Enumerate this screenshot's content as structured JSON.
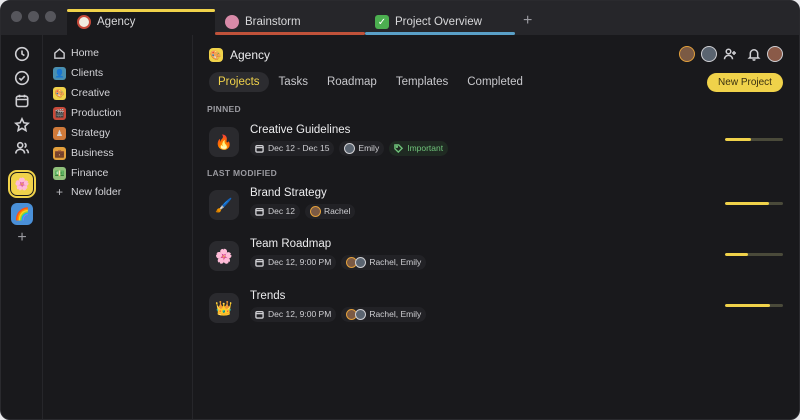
{
  "tabs": [
    {
      "label": "Agency",
      "icon": "agency-icon",
      "color": "#f0d24a"
    },
    {
      "label": "Brainstorm",
      "icon": "brain-icon",
      "color": "#c0523a"
    },
    {
      "label": "Project Overview",
      "icon": "check-icon",
      "color": "#5aa0c8"
    }
  ],
  "sidebar": {
    "items": [
      {
        "label": "Home",
        "icon": "home-icon"
      },
      {
        "label": "Clients",
        "icon": "clients-icon",
        "color": "#4a8fb0"
      },
      {
        "label": "Creative",
        "icon": "creative-icon",
        "color": "#f0d24a"
      },
      {
        "label": "Production",
        "icon": "production-icon",
        "color": "#c84a3a"
      },
      {
        "label": "Strategy",
        "icon": "strategy-icon",
        "color": "#d07a3a"
      },
      {
        "label": "Business",
        "icon": "business-icon",
        "color": "#e3a03c"
      },
      {
        "label": "Finance",
        "icon": "finance-icon",
        "color": "#8fc07a"
      },
      {
        "label": "New folder",
        "icon": "plus-icon"
      }
    ]
  },
  "header": {
    "title": "Agency",
    "tabs": [
      "Projects",
      "Tasks",
      "Roadmap",
      "Templates",
      "Completed"
    ],
    "active_tab": "Projects",
    "new_button": "New Project"
  },
  "sections": {
    "pinned": "PINNED",
    "last_modified": "LAST MODIFIED"
  },
  "projects": [
    {
      "title": "Creative Guidelines",
      "icon": "fire-icon",
      "glyph": "🔥",
      "date": "Dec 12 - Dec 15",
      "people": "Emily",
      "tag": "Important",
      "progress": 0.45
    },
    {
      "title": "Brand Strategy",
      "icon": "brush-icon",
      "glyph": "🖌️",
      "date": "Dec 12",
      "people": "Rachel",
      "progress": 0.75
    },
    {
      "title": "Team Roadmap",
      "icon": "flower-icon",
      "glyph": "🌸",
      "date": "Dec 12, 9:00 PM",
      "people": "Rachel, Emily",
      "progress": 0.4
    },
    {
      "title": "Trends",
      "icon": "crown-icon",
      "glyph": "👑",
      "date": "Dec 12, 9:00 PM",
      "people": "Rachel, Emily",
      "progress": 0.78
    }
  ]
}
